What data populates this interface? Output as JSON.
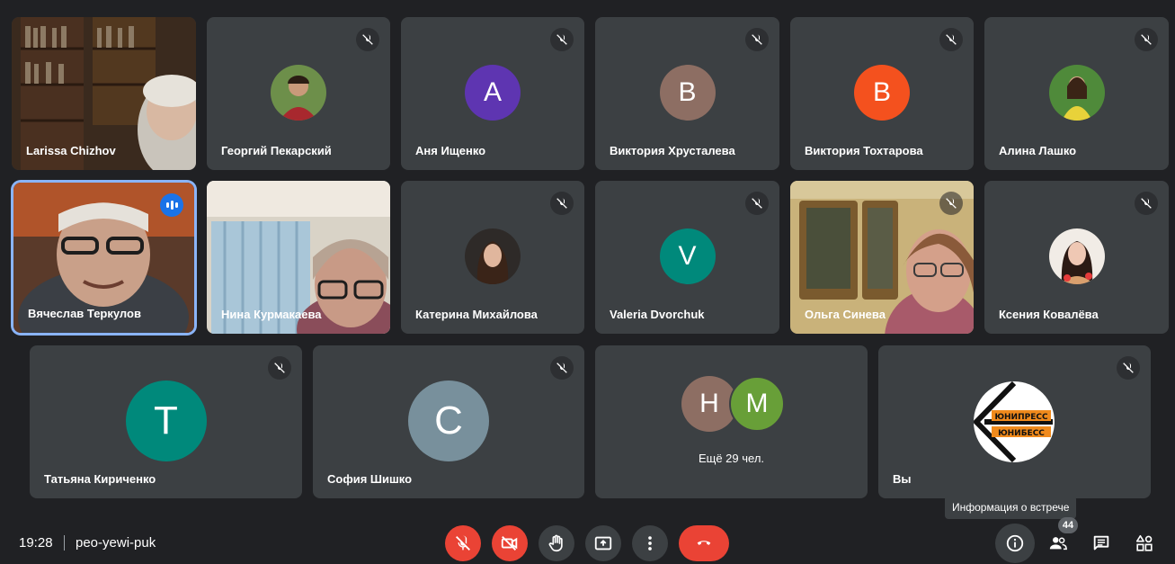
{
  "participants": {
    "p1": "Larissa Chizhov",
    "p2": "Георгий Пекарский",
    "p3": "Аня Ищенко",
    "p4": "Виктория Хрусталева",
    "p5": "Виктория Тохтарова",
    "p6": "Алина Лашко",
    "p7": "Вячеслав Теркулов",
    "p8": "Нина Курмакаева",
    "p9": "Катерина Михайлова",
    "p10": "Valeria Dvorchuk",
    "p11": "Ольга Синева",
    "p12": "Ксения Ковалёва",
    "p13": "Татьяна Кириченко",
    "p14": "София Шишко",
    "p15": "Вы"
  },
  "avatars": {
    "p3": {
      "letter": "А",
      "color": "#5e35b1"
    },
    "p4": {
      "letter": "В",
      "color": "#8d6e63"
    },
    "p5": {
      "letter": "В",
      "color": "#f4511e"
    },
    "p10": {
      "letter": "V",
      "color": "#00897b"
    },
    "p13": {
      "letter": "Т",
      "color": "#00897b"
    },
    "p14": {
      "letter": "С",
      "color": "#78909c"
    },
    "more1": {
      "letter": "Н",
      "color": "#8d6e63"
    },
    "more2": {
      "letter": "М",
      "color": "#689f38"
    }
  },
  "more": {
    "label": "Ещё 29 чел."
  },
  "logo": {
    "line1": "ЮНИПРЕСС",
    "line2": "ЮНИБЕСС"
  },
  "bottom": {
    "time": "19:28",
    "code": "peo-yewi-puk",
    "people_count": "44",
    "tooltip": "Информация о встрече"
  },
  "colors": {
    "accent": "#8ab4f8",
    "danger": "#ea4335",
    "tile": "#3c4043",
    "background": "#202124"
  },
  "icons": [
    "mic-off-icon",
    "camera-off-icon",
    "hand-icon",
    "present-icon",
    "more-vert-icon",
    "end-call-icon",
    "info-icon",
    "people-icon",
    "chat-icon",
    "activities-icon",
    "speaking-icon"
  ]
}
